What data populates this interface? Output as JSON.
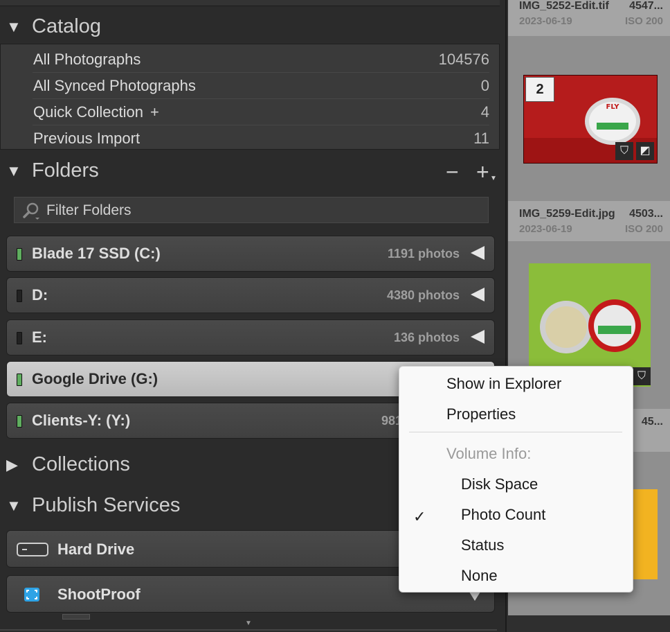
{
  "catalog": {
    "title": "Catalog",
    "items": [
      {
        "label": "All Photographs",
        "count": "104576"
      },
      {
        "label": "All Synced Photographs",
        "count": "0"
      },
      {
        "label": "Quick Collection",
        "plus": "+",
        "count": "4"
      },
      {
        "label": "Previous Import",
        "count": "11"
      }
    ]
  },
  "folders": {
    "title": "Folders",
    "remove_label": "−",
    "add_label": "+",
    "filter_placeholder": "Filter Folders",
    "volumes": [
      {
        "name": "Blade 17 SSD (C:)",
        "count": "1191 photos",
        "status": "online"
      },
      {
        "name": "D:",
        "count": "4380 photos",
        "status": "offline"
      },
      {
        "name": "E:",
        "count": "136 photos",
        "status": "offline"
      },
      {
        "name": "Google Drive (G:)",
        "count": "",
        "status": "online",
        "selected": true
      },
      {
        "name": "Clients-Y: (Y:)",
        "count": "981",
        "status": "online"
      }
    ]
  },
  "collections": {
    "title": "Collections"
  },
  "publish": {
    "title": "Publish Services",
    "services": [
      {
        "name": "Hard Drive",
        "icon": "hard-drive-icon"
      },
      {
        "name": "ShootProof",
        "icon": "shootproof-icon"
      }
    ]
  },
  "filmstrip": {
    "cells": [
      {
        "filename": "IMG_5252-Edit.tif",
        "size": "4547...",
        "date": "2023-06-19",
        "iso": "ISO 200"
      },
      {
        "badge": "2",
        "filename": "IMG_5259-Edit.jpg",
        "size": "4503...",
        "date": "2023-06-19",
        "iso": "ISO 200",
        "thumb_color": "#b51c1c"
      },
      {
        "size": "45...",
        "thumb_color": "#8bbd3a"
      },
      {
        "thumb_color": "#f2b321"
      }
    ]
  },
  "context_menu": {
    "items": [
      {
        "label": "Show in Explorer"
      },
      {
        "label": "Properties"
      },
      {
        "label": "Volume Info:",
        "disabled": true
      },
      {
        "label": "Disk Space"
      },
      {
        "label": "Photo Count",
        "checked": true,
        "check": "✓"
      },
      {
        "label": "Status"
      },
      {
        "label": "None"
      }
    ]
  },
  "colors": {
    "panel_bg": "#2b2b2b",
    "selected_volume": "#c4c4c4",
    "online_led": "#5fae5f"
  }
}
